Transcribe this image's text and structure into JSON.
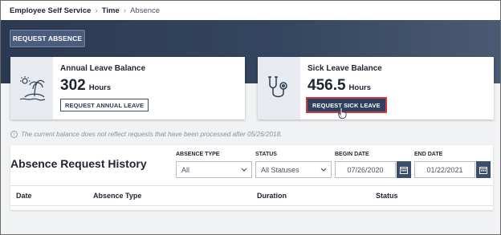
{
  "breadcrumb": {
    "items": [
      "Employee Self Service",
      "Time"
    ],
    "current": "Absence"
  },
  "toolbar": {
    "request_absence_label": "REQUEST ABSENCE"
  },
  "annual_card": {
    "icon": "beach-island-icon",
    "title": "Annual Leave Balance",
    "value": "302",
    "unit": "Hours",
    "button_label": "REQUEST ANNUAL LEAVE"
  },
  "sick_card": {
    "icon": "stethoscope-icon",
    "title": "Sick Leave Balance",
    "value": "456.5",
    "unit": "Hours",
    "button_label": "REQUEST SICK LEAVE"
  },
  "notice": {
    "icon": "info-icon",
    "text": "The current balance does not reflect requests that have been processed after 05/26/2018."
  },
  "history": {
    "title": "Absence Request History",
    "filters": {
      "absence_type": {
        "label": "ABSENCE TYPE",
        "value": "All"
      },
      "status": {
        "label": "STATUS",
        "value": "All Statuses"
      },
      "begin_date": {
        "label": "BEGIN DATE",
        "value": "07/26/2020"
      },
      "end_date": {
        "label": "END DATE",
        "value": "01/22/2021"
      }
    },
    "columns": [
      "Date",
      "Absence Type",
      "Duration",
      "Status"
    ]
  },
  "colors": {
    "band": "#2b3a52",
    "button_dark": "#2f4160",
    "highlight": "#d23b3b"
  }
}
